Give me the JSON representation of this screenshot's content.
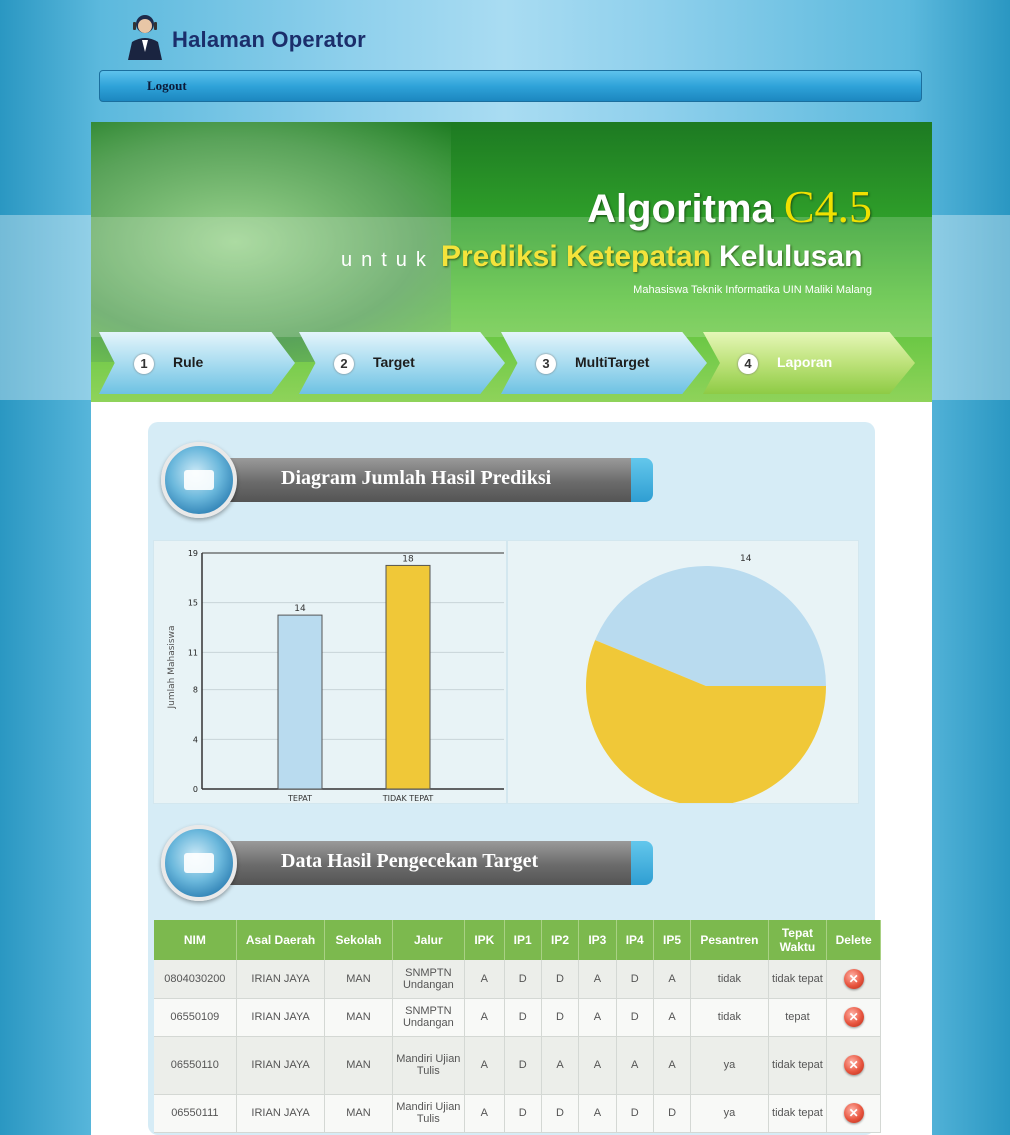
{
  "header": {
    "site_title": "Halaman Operator",
    "logout_label": "Logout"
  },
  "banner": {
    "title_main": "Algoritma",
    "title_version": "C4.5",
    "subtitle_untuk": "untuk",
    "subtitle_prediksi": "Prediksi Ketepatan",
    "subtitle_kelulusan": "Kelulusan",
    "note": "Mahasiswa Teknik Informatika UIN Maliki Malang"
  },
  "steps": [
    {
      "num": "1",
      "label": "Rule"
    },
    {
      "num": "2",
      "label": "Target"
    },
    {
      "num": "3",
      "label": "MultiTarget"
    },
    {
      "num": "4",
      "label": "Laporan"
    }
  ],
  "sections": {
    "chart_title": "Diagram Jumlah Hasil Prediksi",
    "table_title": "Data Hasil Pengecekan Target"
  },
  "colors": {
    "tepat": "#b9dbef",
    "tidak_tepat": "#f0c838",
    "header_green": "#7cb94e"
  },
  "chart_data": [
    {
      "type": "bar",
      "categories": [
        "TEPAT",
        "TIDAK TEPAT"
      ],
      "values": [
        14,
        18
      ],
      "ylabel": "Jumlah Mahasiswa",
      "ylim": [
        0,
        19
      ],
      "yticks": [
        "0",
        "4",
        "8",
        "11",
        "15",
        "19"
      ],
      "grid": true
    },
    {
      "type": "pie",
      "categories": [
        "TEPAT",
        "TIDAK TEPAT"
      ],
      "values": [
        14,
        18
      ],
      "visible_labels": [
        "14"
      ]
    }
  ],
  "table": {
    "headers": [
      "NIM",
      "Asal Daerah",
      "Sekolah",
      "Jalur",
      "IPK",
      "IP1",
      "IP2",
      "IP3",
      "IP4",
      "IP5",
      "Pesantren",
      "Tepat Waktu",
      "Delete"
    ],
    "rows": [
      [
        "0804030200",
        "IRIAN JAYA",
        "MAN",
        "SNMPTN Undangan",
        "A",
        "D",
        "D",
        "A",
        "D",
        "A",
        "tidak",
        "tidak tepat"
      ],
      [
        "06550109",
        "IRIAN JAYA",
        "MAN",
        "SNMPTN Undangan",
        "A",
        "D",
        "D",
        "A",
        "D",
        "A",
        "tidak",
        "tepat"
      ],
      [
        "06550110",
        "IRIAN JAYA",
        "MAN",
        "Mandiri Ujian Tulis",
        "A",
        "D",
        "A",
        "A",
        "A",
        "A",
        "ya",
        "tidak tepat"
      ],
      [
        "06550111",
        "IRIAN JAYA",
        "MAN",
        "Mandiri Ujian Tulis",
        "A",
        "D",
        "D",
        "A",
        "D",
        "D",
        "ya",
        "tidak tepat"
      ]
    ]
  }
}
